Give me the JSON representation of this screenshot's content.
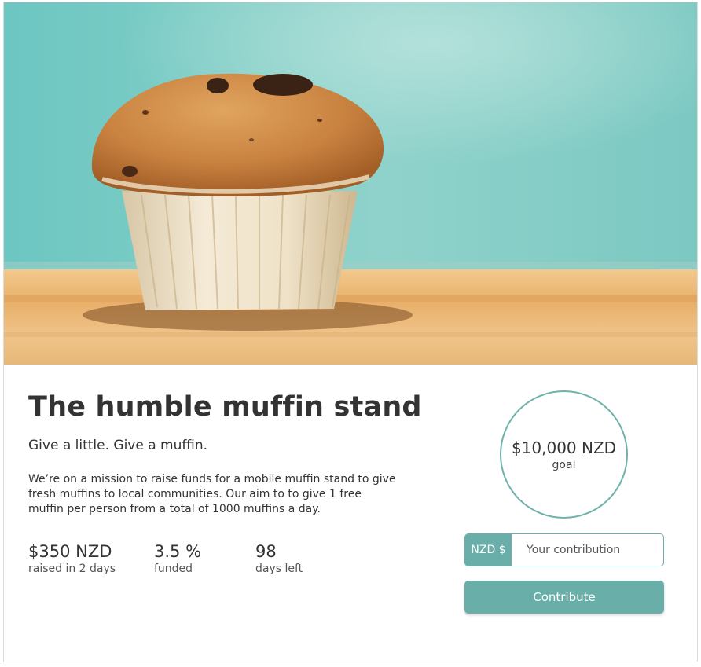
{
  "hero": {
    "image": "muffin-on-table-photo"
  },
  "campaign": {
    "title": "The humble muffin stand",
    "tagline": "Give a little. Give a muffin.",
    "description": "We’re on a mission to raise funds for a mobile muffin stand to give fresh muffins to local communities. Our aim to to give 1 free muffin per person from a total of 1000 muffins a day."
  },
  "stats": {
    "raised": {
      "value": "$350 NZD",
      "label": "raised in 2 days"
    },
    "funded": {
      "value": "3.5 %",
      "label": "funded"
    },
    "days_left": {
      "value": "98",
      "label": "days left"
    }
  },
  "goal": {
    "amount": "$10,000 NZD",
    "label": "goal"
  },
  "contribution": {
    "currency_prefix": "NZD $",
    "placeholder": "Your contribution",
    "value": "",
    "button_label": "Contribute"
  },
  "colors": {
    "accent": "#6aaea9",
    "text": "#333333",
    "sky": "#7fcdc6",
    "table": "#e9b675"
  }
}
